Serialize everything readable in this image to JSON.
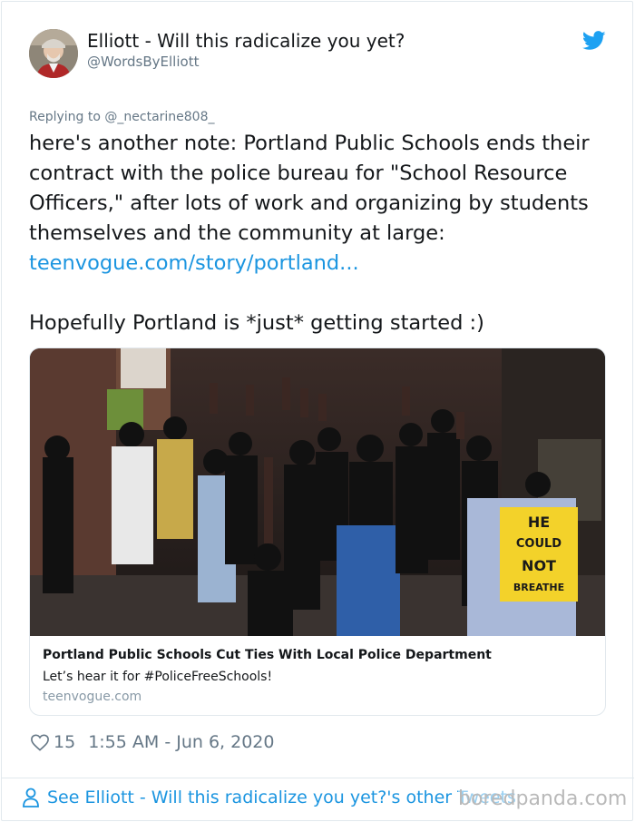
{
  "tweet": {
    "author_name": "Elliott - Will this radicalize you yet?",
    "author_handle": "@WordsByElliott",
    "reply_prefix": "Replying to",
    "reply_to": "@_nectarine808_",
    "body_text": "here's another note: Portland Public Schools ends their contract with the police bureau for \"School Resource Officers,\" after lots of work and organizing by students themselves and the community at large: ",
    "body_link": "teenvogue.com/story/portland...",
    "body_text_2": "Hopefully Portland is *just* getting started :)",
    "card": {
      "title": "Portland Public Schools Cut Ties With Local Police Department",
      "description": "Let’s hear it for #PoliceFreeSchools!",
      "domain": "teenvogue.com",
      "sign_text": [
        "HE",
        "COULD",
        "NOT",
        "BREATHE"
      ]
    },
    "like_count": "15",
    "timestamp": "1:55 AM - Jun 6, 2020",
    "see_more": "See Elliott - Will this radicalize you yet?'s other Tweets"
  },
  "watermark": "boredpanda.com",
  "colors": {
    "link": "#1b95e0",
    "twitter_blue": "#1da1f2",
    "secondary_text": "#657786",
    "border": "#e1e8ed"
  },
  "icons": [
    "twitter-bird-icon",
    "heart-icon",
    "person-icon"
  ]
}
